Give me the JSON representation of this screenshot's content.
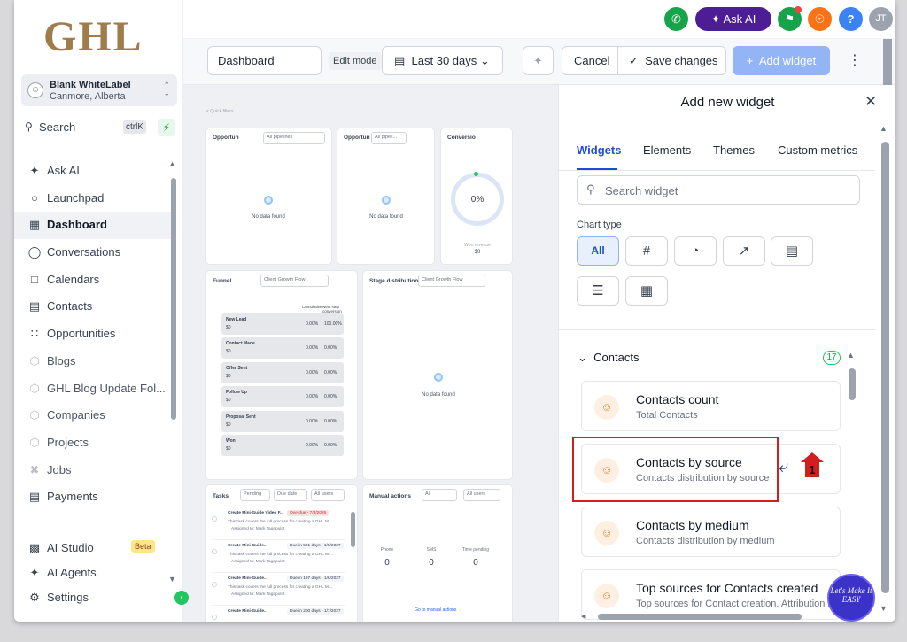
{
  "sidebar": {
    "logo": "GHL",
    "account": {
      "name": "Blank WhiteLabel",
      "location": "Canmore, Alberta"
    },
    "search": {
      "label": "Search",
      "shortcut": "ctrlK"
    },
    "items": [
      {
        "label": "Ask AI",
        "icon": "sparkle-icon"
      },
      {
        "label": "Launchpad",
        "icon": "rocket-icon"
      },
      {
        "label": "Dashboard",
        "icon": "grid-icon"
      },
      {
        "label": "Conversations",
        "icon": "chat-icon"
      },
      {
        "label": "Calendars",
        "icon": "calendar-icon"
      },
      {
        "label": "Contacts",
        "icon": "contacts-icon"
      },
      {
        "label": "Opportunities",
        "icon": "funnel-icon"
      },
      {
        "label": "Blogs",
        "icon": "cube-icon"
      },
      {
        "label": "GHL Blog Update Fol...",
        "icon": "cube-icon"
      },
      {
        "label": "Companies",
        "icon": "cube-icon"
      },
      {
        "label": "Projects",
        "icon": "cube-icon"
      },
      {
        "label": "Jobs",
        "icon": "jobs-icon"
      },
      {
        "label": "Payments",
        "icon": "payments-icon"
      }
    ],
    "bottom": [
      {
        "label": "AI Studio",
        "badge": "Beta",
        "icon": "ai-studio-icon"
      },
      {
        "label": "AI Agents",
        "icon": "sparkle-icon"
      },
      {
        "label": "Settings",
        "icon": "gear-icon"
      }
    ]
  },
  "topbar": {
    "ask_ai": "Ask AI",
    "avatar": "JT",
    "help": "?"
  },
  "toolbar": {
    "dashboard_name": "Dashboard",
    "edit_mode": "Edit mode",
    "date_range": "Last 30 days",
    "cancel": "Cancel",
    "save": "Save changes",
    "add_widget": "Add widget"
  },
  "canvas": {
    "quick_filters": "< Quick filters",
    "w1": {
      "title": "Opportun",
      "select": "All pipelines",
      "empty": "No data found"
    },
    "w2": {
      "title": "Opportun",
      "select": "All pipeli...",
      "empty": "No data found"
    },
    "w3": {
      "title": "Conversio",
      "value": "0%",
      "sub": "Won revenue",
      "amount": "$0"
    },
    "funnel": {
      "title": "Funnel",
      "select": "Client Growth Flow",
      "col1": "Cumulative",
      "col2": "Next step conversion",
      "rows": [
        {
          "stage": "New Lead",
          "amount": "$0",
          "c1": "0.00%",
          "c2": "100.00%"
        },
        {
          "stage": "Contact Made",
          "amount": "$0",
          "c1": "0.00%",
          "c2": "0.00%"
        },
        {
          "stage": "Offer Sent",
          "amount": "$0",
          "c1": "0.00%",
          "c2": "0.00%"
        },
        {
          "stage": "Follow Up",
          "amount": "$0",
          "c1": "0.00%",
          "c2": "0.00%"
        },
        {
          "stage": "Proposal Sent",
          "amount": "$0",
          "c1": "0.00%",
          "c2": "0.00%"
        },
        {
          "stage": "Won",
          "amount": "$0",
          "c1": "0.00%",
          "c2": "0.00%"
        }
      ]
    },
    "stage": {
      "title": "Stage distribution",
      "select": "Client Growth Flow",
      "empty": "No data found"
    },
    "tasks": {
      "title": "Tasks",
      "f1": "Pending",
      "f2": "Due date",
      "f3": "All users",
      "items": [
        {
          "name": "Create Mini-Guide Video F...",
          "badge": "Overdue - 7/3/2026",
          "desc": "This task covers the full process for creating a GHL Mi...",
          "assigned": "Assigned to: Mark Tagapulot"
        },
        {
          "name": "Create Mini-Guide...",
          "badge": "Due in 591 days - 1/5/2027",
          "desc": "This task covers the full process for creating a GHL Mi...",
          "assigned": "Assigned to: Mark Tagapulot"
        },
        {
          "name": "Create Mini-Guide...",
          "badge": "Due in 197 days - 1/6/2027",
          "desc": "This task covers the full process for creating a GHL Mi...",
          "assigned": "Assigned to: Mark Tagapulot"
        },
        {
          "name": "Create Mini-Guide...",
          "badge": "Due in 200 days - 1/7/2027",
          "desc": "",
          "assigned": ""
        }
      ]
    },
    "manual": {
      "title": "Manual actions",
      "f1": "All",
      "f2": "All users",
      "cols": [
        {
          "label": "Phone",
          "value": "0"
        },
        {
          "label": "SMS",
          "value": "0"
        },
        {
          "label": "Time pending",
          "value": "0"
        }
      ],
      "link": "Go to manual actions →"
    }
  },
  "panel": {
    "title": "Add new widget",
    "tabs": [
      "Widgets",
      "Elements",
      "Themes",
      "Custom metrics"
    ],
    "search_placeholder": "Search widget",
    "chart_type_label": "Chart type",
    "chart_types": [
      "All",
      "#",
      "pie-icon",
      "line-icon",
      "bar-icon",
      "hbar-icon",
      "table-icon"
    ],
    "section": {
      "title": "Contacts",
      "count": "17"
    },
    "widgets": [
      {
        "title": "Contacts count",
        "subtitle": "Total Contacts"
      },
      {
        "title": "Contacts by source",
        "subtitle": "Contacts distribution by source"
      },
      {
        "title": "Contacts by medium",
        "subtitle": "Contacts distribution by medium"
      },
      {
        "title": "Top sources for Contacts created",
        "subtitle": "Top sources for Contact creation. Attribution is"
      }
    ]
  },
  "annotation": {
    "step": "1",
    "watermark": "Let's Make It EASY"
  },
  "colors": {
    "primary": "#1d4ed8",
    "highlight": "#d11f1f",
    "logo": "#a07c4b",
    "accent": "#ea8a3a"
  }
}
